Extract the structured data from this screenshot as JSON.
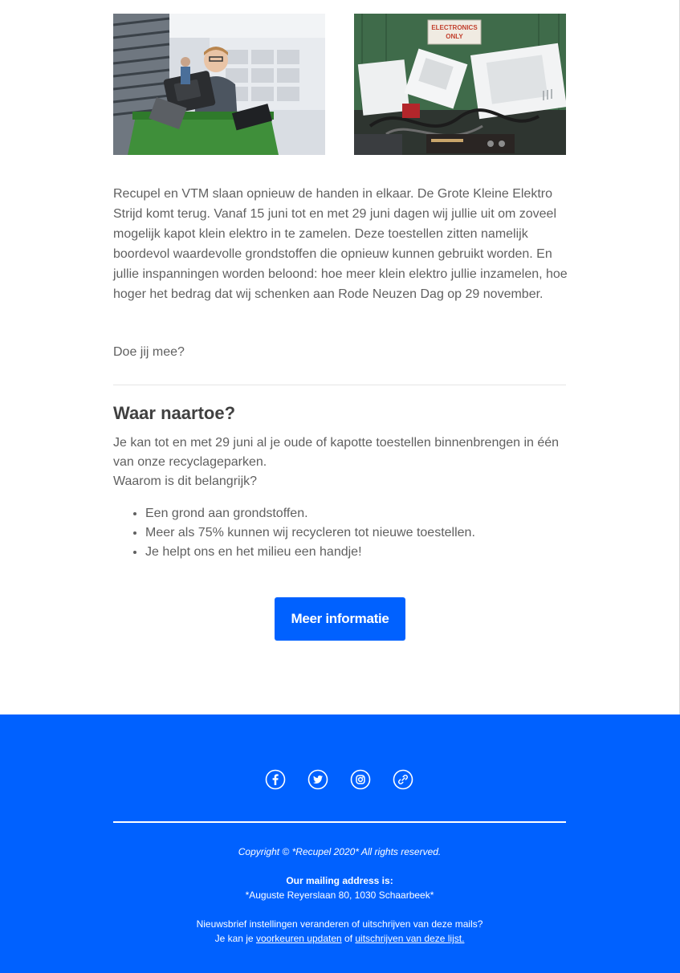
{
  "images": {
    "left": {
      "description": "Jongen met kapot elektro toestel in recyclagepark"
    },
    "right": {
      "sign_text_line1": "ELECTRONICS",
      "sign_text_line2": "ONLY"
    }
  },
  "intro": {
    "paragraph": "Recupel en VTM slaan opnieuw de handen in elkaar. De Grote Kleine Elektro Strijd komt terug. Vanaf 15 juni tot en met 29 juni dagen wij jullie uit om zoveel mogelijk kapot klein elektro in te zamelen. Deze toestellen zitten namelijk boordevol waardevolle grondstoffen die opnieuw kunnen gebruikt worden. En jullie inspanningen worden beloond: hoe meer klein elektro jullie inzamelen, hoe hoger het bedrag dat wij schenken aan Rode Neuzen Dag op 29 november.",
    "question": "Doe jij mee?"
  },
  "section": {
    "heading": "Waar naartoe?",
    "paragraph": "Je kan tot en met 29 juni al je oude of kapotte toestellen binnenbrengen in één van onze recyclageparken.",
    "subline": "Waarom is dit belangrijk?",
    "bullets": [
      "Een grond aan grondstoffen.",
      "Meer als 75% kunnen wij recycleren tot nieuwe toestellen.",
      "Je helpt ons en het milieu een handje!"
    ],
    "button_label": "Meer informatie"
  },
  "footer": {
    "social_icons": [
      "facebook-icon",
      "twitter-icon",
      "instagram-icon",
      "link-icon"
    ],
    "copyright": "Copyright © *Recupel 2020* All rights reserved.",
    "mailing_label": "Our mailing address is:",
    "mailing_address": "*Auguste Reyerslaan 80, 1030 Schaarbeek*",
    "prefs_question": "Nieuwsbrief instellingen veranderen of uitschrijven van deze mails?",
    "prefs_prefix": "Je kan je ",
    "prefs_link1": "voorkeuren updaten",
    "prefs_middle": " of ",
    "prefs_link2": "uitschrijven van deze lijst."
  },
  "colors": {
    "brand_blue": "#0061ff",
    "text_gray": "#606060",
    "heading_gray": "#404040",
    "white": "#ffffff"
  }
}
